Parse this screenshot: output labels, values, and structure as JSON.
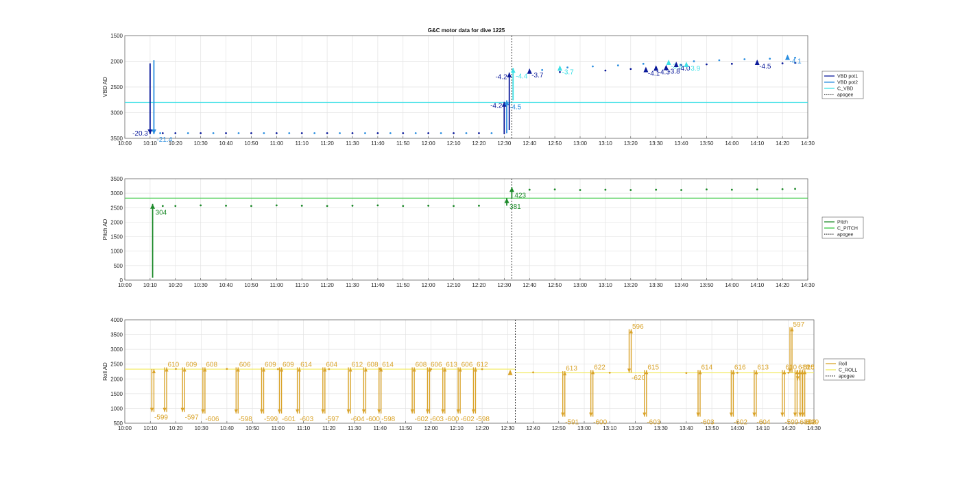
{
  "title": "G&C motor data for dive 1225",
  "colors": {
    "vbd_pot1": "#0b1a9a",
    "vbd_pot2": "#2c8fe0",
    "c_vbd": "#3ee0e6",
    "pitch": "#1d8a2a",
    "c_pitch": "#36c73e",
    "roll": "#d9a32a",
    "c_roll": "#f2ea5c",
    "apogee": "#222222",
    "grid": "#e3e3e3"
  },
  "x_ticks": [
    "10:00",
    "10:10",
    "10:20",
    "10:30",
    "10:40",
    "10:50",
    "11:00",
    "11:10",
    "11:20",
    "11:30",
    "11:40",
    "11:50",
    "12:00",
    "12:10",
    "12:20",
    "12:30",
    "12:40",
    "12:50",
    "13:00",
    "13:10",
    "13:20",
    "13:30",
    "13:40",
    "13:50",
    "14:00",
    "14:10",
    "14:20",
    "14:30"
  ],
  "chart_data": [
    {
      "type": "scatter",
      "title": "G&C motor data for dive 1225",
      "ylabel": "VBD AD",
      "ylim": [
        1500,
        3500
      ],
      "y_reversed": true,
      "xlim": [
        "10:00",
        "14:30"
      ],
      "yticks": [
        1500,
        2000,
        2500,
        3000,
        3500
      ],
      "grid": true,
      "legend": "right",
      "legend_entries": [
        "VBD pot1",
        "VBD pot2",
        "C_VBD",
        "apogee"
      ],
      "c_value": 2800,
      "apogee": "12:33",
      "series": [
        {
          "name": "VBD pot1",
          "x": [
            "10:15",
            "10:20",
            "10:30",
            "10:40",
            "10:50",
            "11:00",
            "11:10",
            "11:20",
            "11:30",
            "11:40",
            "11:50",
            "12:00",
            "12:10",
            "12:20",
            "12:52",
            "13:10",
            "13:20",
            "13:30",
            "13:40",
            "13:50",
            "14:00",
            "14:10",
            "14:20",
            "14:25"
          ],
          "values": [
            3400,
            3400,
            3400,
            3400,
            3400,
            3400,
            3400,
            3400,
            3400,
            3400,
            3400,
            3400,
            3400,
            3400,
            2210,
            2180,
            2150,
            2120,
            2070,
            2060,
            2050,
            2050,
            2040,
            2030
          ]
        },
        {
          "name": "VBD pot2",
          "x": [
            "10:14",
            "10:25",
            "10:35",
            "10:45",
            "10:55",
            "11:05",
            "11:15",
            "11:25",
            "11:35",
            "11:45",
            "11:55",
            "12:05",
            "12:15",
            "12:25",
            "12:45",
            "12:55",
            "13:05",
            "13:15",
            "13:25",
            "13:35",
            "13:45",
            "13:55",
            "14:05",
            "14:15",
            "14:25"
          ],
          "values": [
            3400,
            3400,
            3400,
            3400,
            3400,
            3400,
            3400,
            3400,
            3400,
            3400,
            3400,
            3400,
            3400,
            3400,
            2170,
            2120,
            2100,
            2080,
            2050,
            2020,
            2000,
            1980,
            1960,
            1950,
            1930
          ]
        },
        {
          "name": "C_VBD",
          "x": [
            "10:00",
            "14:30"
          ],
          "values": [
            2800,
            2800
          ]
        }
      ],
      "moves": [
        {
          "x": "10:10",
          "from": 2040,
          "to": 3420,
          "color": "vbd_pot1",
          "label": "-20.3",
          "label_side": "left",
          "label_y": 3390
        },
        {
          "x": "10:11.5",
          "from": 1980,
          "to": 3420,
          "color": "vbd_pot2",
          "label": "-21.4",
          "label_side": "right",
          "label_y": 3510
        },
        {
          "x": "12:30",
          "from": 3420,
          "to": 2790,
          "color": "vbd_pot1",
          "label": "-4.2",
          "label_side": "left",
          "label_y": 2850
        },
        {
          "x": "12:31",
          "from": 3400,
          "to": 2760,
          "color": "vbd_pot2",
          "label": "-4.5",
          "label_side": "right",
          "label_y": 2880
        },
        {
          "x": "12:32",
          "from": 3340,
          "to": 2220,
          "color": "vbd_pot1",
          "label": "-4.2",
          "label_side": "left",
          "label_y": 2290
        },
        {
          "x": "12:33.5",
          "from": 2760,
          "to": 2130,
          "color": "c_vbd",
          "label": "-4.4",
          "label_side": "right",
          "label_y": 2280
        }
      ],
      "small_markers": [
        {
          "x": "12:40",
          "y": 2190,
          "color": "vbd_pot1",
          "label": "-3.7"
        },
        {
          "x": "12:52",
          "y": 2130,
          "color": "c_vbd",
          "label": "-3.7"
        },
        {
          "x": "13:26",
          "y": 2160,
          "color": "vbd_pot1",
          "label": "-4.1"
        },
        {
          "x": "13:30",
          "y": 2130,
          "color": "vbd_pot1",
          "label": "-4.3"
        },
        {
          "x": "13:34",
          "y": 2120,
          "color": "vbd_pot1",
          "label": "-3.8"
        },
        {
          "x": "13:35",
          "y": 2020,
          "color": "c_vbd",
          "label": "-3.9"
        },
        {
          "x": "13:38",
          "y": 2060,
          "color": "vbd_pot1",
          "label": "-4.0"
        },
        {
          "x": "13:42",
          "y": 2060,
          "color": "c_vbd",
          "label": "-3.9"
        },
        {
          "x": "14:10",
          "y": 2020,
          "color": "vbd_pot1",
          "label": "-4.5"
        },
        {
          "x": "14:22",
          "y": 1920,
          "color": "vbd_pot2",
          "label": "-4.1"
        }
      ]
    },
    {
      "type": "scatter",
      "ylabel": "Pitch AD",
      "ylim": [
        0,
        3500
      ],
      "xlim": [
        "10:00",
        "14:30"
      ],
      "yticks": [
        0,
        500,
        1000,
        1500,
        2000,
        2500,
        3000,
        3500
      ],
      "grid": true,
      "legend": "right",
      "legend_entries": [
        "Pitch",
        "C_PITCH",
        "apogee"
      ],
      "c_value": 2830,
      "apogee": "12:33",
      "series": [
        {
          "name": "Pitch",
          "x": [
            "10:15",
            "10:20",
            "10:30",
            "10:40",
            "10:50",
            "11:00",
            "11:10",
            "11:20",
            "11:30",
            "11:40",
            "11:50",
            "12:00",
            "12:10",
            "12:20",
            "12:40",
            "12:50",
            "13:00",
            "13:10",
            "13:20",
            "13:30",
            "13:40",
            "13:50",
            "14:00",
            "14:10",
            "14:20",
            "14:25"
          ],
          "values": [
            2560,
            2560,
            2580,
            2570,
            2560,
            2580,
            2570,
            2560,
            2570,
            2580,
            2560,
            2570,
            2560,
            2570,
            3120,
            3130,
            3110,
            3120,
            3110,
            3120,
            3110,
            3130,
            3120,
            3130,
            3140,
            3150
          ]
        },
        {
          "name": "C_PITCH",
          "x": [
            "10:00",
            "14:30"
          ],
          "values": [
            2830,
            2830
          ]
        }
      ],
      "moves": [
        {
          "x": "10:11",
          "from": 80,
          "to": 2630,
          "color": "pitch",
          "label": "304",
          "label_side": "right",
          "label_y": 2350
        },
        {
          "x": "12:31",
          "from": 2570,
          "to": 2830,
          "color": "pitch",
          "label": "381",
          "label_side": "right",
          "label_y": 2550
        },
        {
          "x": "12:33",
          "from": 2830,
          "to": 3210,
          "color": "pitch",
          "label": "423",
          "label_side": "right",
          "label_y": 2950
        }
      ]
    },
    {
      "type": "scatter",
      "ylabel": "Roll AD",
      "ylim": [
        500,
        4000
      ],
      "xlim": [
        "10:00",
        "14:30"
      ],
      "yticks": [
        500,
        1000,
        1500,
        2000,
        2500,
        3000,
        3500,
        4000
      ],
      "grid": true,
      "legend": "right",
      "legend_entries": [
        "Roll",
        "C_ROLL",
        "apogee"
      ],
      "c_value": 2330,
      "c_value_after_apogee": 2210,
      "apogee": "12:33",
      "series": [
        {
          "name": "Roll",
          "x": [
            "10:20",
            "10:40",
            "11:00",
            "11:20",
            "11:40",
            "12:00",
            "12:20",
            "12:40",
            "13:10",
            "13:40",
            "14:00",
            "14:20"
          ],
          "values": [
            2340,
            2340,
            2330,
            2330,
            2340,
            2330,
            2330,
            2220,
            2210,
            2200,
            2210,
            2210
          ]
        }
      ],
      "swings": [
        {
          "x": "10:11",
          "low": 880,
          "high": 2330,
          "low_label": "-599"
        },
        {
          "x": "10:16",
          "low": 880,
          "high": 2390,
          "high_label": "610"
        },
        {
          "x": "10:23",
          "low": 880,
          "high": 2390,
          "low_label": "-597",
          "high_label": "609"
        },
        {
          "x": "10:31",
          "low": 830,
          "high": 2390,
          "low_label": "-606",
          "high_label": "608"
        },
        {
          "x": "10:44",
          "low": 830,
          "high": 2390,
          "low_label": "-598",
          "high_label": "606"
        },
        {
          "x": "10:54",
          "low": 830,
          "high": 2390,
          "low_label": "-599",
          "high_label": "609"
        },
        {
          "x": "11:01",
          "low": 830,
          "high": 2390,
          "low_label": "-601",
          "high_label": "609"
        },
        {
          "x": "11:08",
          "low": 830,
          "high": 2390,
          "low_label": "-603",
          "high_label": "614"
        },
        {
          "x": "11:18",
          "low": 830,
          "high": 2390,
          "low_label": "-597",
          "high_label": "604"
        },
        {
          "x": "11:28",
          "low": 830,
          "high": 2390,
          "low_label": "-604",
          "high_label": "612"
        },
        {
          "x": "11:34",
          "low": 830,
          "high": 2390,
          "low_label": "-600",
          "high_label": "608"
        },
        {
          "x": "11:40",
          "low": 830,
          "high": 2390,
          "low_label": "-598",
          "high_label": "614"
        },
        {
          "x": "11:53",
          "low": 830,
          "high": 2390,
          "low_label": "-602",
          "high_label": "608"
        },
        {
          "x": "11:59",
          "low": 830,
          "high": 2390,
          "low_label": "-603",
          "high_label": "606"
        },
        {
          "x": "12:05",
          "low": 830,
          "high": 2390,
          "low_label": "-600",
          "high_label": "613"
        },
        {
          "x": "12:11",
          "low": 830,
          "high": 2390,
          "low_label": "-602",
          "high_label": "606"
        },
        {
          "x": "12:17",
          "low": 830,
          "high": 2390,
          "low_label": "-598",
          "high_label": "612"
        },
        {
          "x": "12:52",
          "low": 720,
          "high": 2260,
          "low_label": "-591",
          "high_label": "613"
        },
        {
          "x": "13:03",
          "low": 720,
          "high": 2300,
          "low_label": "-600",
          "high_label": "622"
        },
        {
          "x": "13:18",
          "low": 2210,
          "high": 3680,
          "low_label": "-620",
          "high_label": "596"
        },
        {
          "x": "13:24",
          "low": 720,
          "high": 2300,
          "low_label": "-603",
          "high_label": "615"
        },
        {
          "x": "13:45",
          "low": 720,
          "high": 2300,
          "low_label": "-603",
          "high_label": "614"
        },
        {
          "x": "13:58",
          "low": 720,
          "high": 2300,
          "low_label": "-602",
          "high_label": "616"
        },
        {
          "x": "14:07",
          "low": 720,
          "high": 2300,
          "low_label": "-604",
          "high_label": "613"
        },
        {
          "x": "14:18",
          "low": 720,
          "high": 2300,
          "low_label": "-599",
          "high_label": "610"
        },
        {
          "x": "14:21",
          "low": 2210,
          "high": 3750,
          "high_label": "597"
        },
        {
          "x": "14:23",
          "low": 720,
          "high": 2300,
          "low_label": "-602",
          "high_label": "618"
        },
        {
          "x": "14:24",
          "low": 1950,
          "high": 2300,
          "high_label": "-620"
        },
        {
          "x": "14:25",
          "low": 720,
          "high": 2300,
          "low_label": "-608",
          "high_label": "615"
        },
        {
          "x": "14:26",
          "low": 720,
          "high": 2300,
          "low_label": "-599"
        }
      ],
      "small_markers": [
        {
          "x": "12:31",
          "y": 2220,
          "color": "roll"
        }
      ]
    }
  ]
}
